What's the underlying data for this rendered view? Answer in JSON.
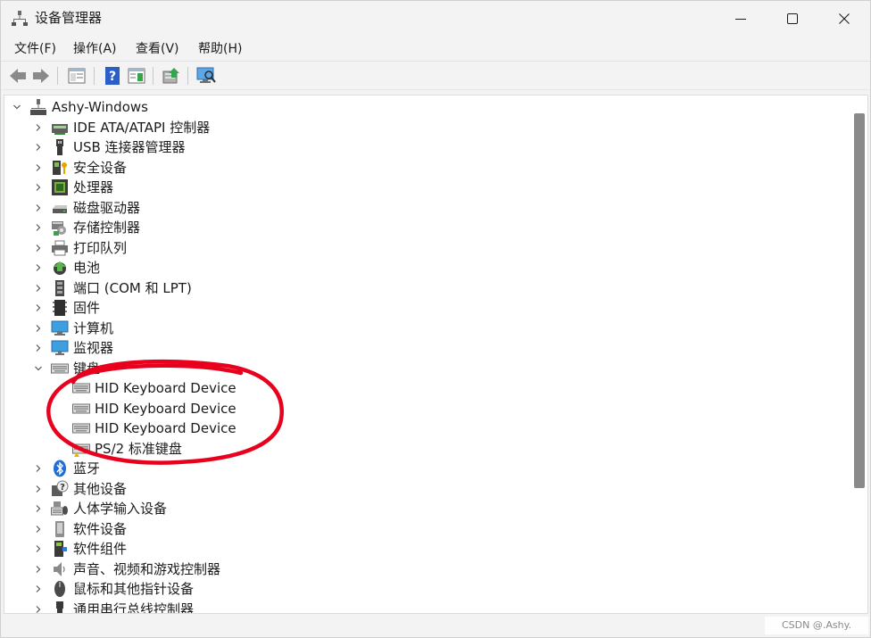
{
  "window": {
    "title": "设备管理器",
    "controls": {
      "minimize": "minimize",
      "maximize": "maximize",
      "close": "close"
    }
  },
  "menu": [
    "文件(F)",
    "操作(A)",
    "查看(V)",
    "帮助(H)"
  ],
  "toolbar": {
    "icons": [
      "back-icon",
      "forward-icon",
      "show-hide-tree-icon",
      "help-icon",
      "properties-icon",
      "update-driver-icon",
      "scan-hardware-icon"
    ]
  },
  "tree": {
    "root": "Ashy-Windows",
    "categories": [
      {
        "label": "IDE ATA/ATAPI 控制器",
        "icon": "ide-controller-icon"
      },
      {
        "label": "USB 连接器管理器",
        "icon": "usb-icon"
      },
      {
        "label": "安全设备",
        "icon": "security-device-icon"
      },
      {
        "label": "处理器",
        "icon": "processor-icon"
      },
      {
        "label": "磁盘驱动器",
        "icon": "disk-drive-icon"
      },
      {
        "label": "存储控制器",
        "icon": "storage-controller-icon"
      },
      {
        "label": "打印队列",
        "icon": "printer-icon"
      },
      {
        "label": "电池",
        "icon": "battery-icon"
      },
      {
        "label": "端口 (COM 和 LPT)",
        "icon": "port-icon"
      },
      {
        "label": "固件",
        "icon": "firmware-icon"
      },
      {
        "label": "计算机",
        "icon": "computer-icon"
      },
      {
        "label": "监视器",
        "icon": "monitor-icon"
      },
      {
        "label": "键盘",
        "icon": "keyboard-icon",
        "expanded": true,
        "children": [
          "HID Keyboard Device",
          "HID Keyboard Device",
          "HID Keyboard Device",
          "PS/2 标准键盘"
        ]
      },
      {
        "label": "蓝牙",
        "icon": "bluetooth-icon"
      },
      {
        "label": "其他设备",
        "icon": "other-device-icon"
      },
      {
        "label": "人体学输入设备",
        "icon": "hid-icon"
      },
      {
        "label": "软件设备",
        "icon": "software-device-icon"
      },
      {
        "label": "软件组件",
        "icon": "software-component-icon"
      },
      {
        "label": "声音、视频和游戏控制器",
        "icon": "sound-icon"
      },
      {
        "label": "鼠标和其他指针设备",
        "icon": "mouse-icon"
      },
      {
        "label": "通用串行总线控制器",
        "icon": "usb-controller-icon"
      }
    ]
  },
  "watermark": "CSDN @.Ashy.",
  "colors": {
    "annotation": "#e8001c",
    "accent": "#1e88e5"
  }
}
